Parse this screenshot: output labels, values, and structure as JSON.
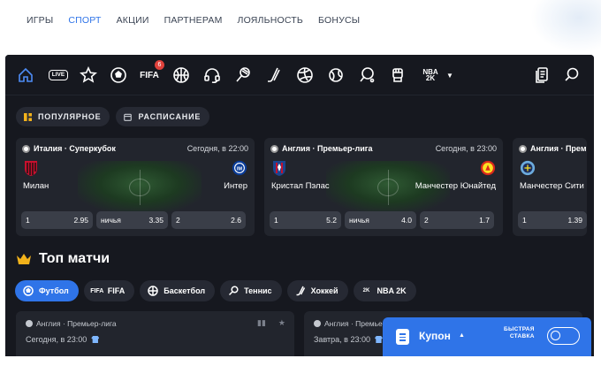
{
  "topnav": {
    "items": [
      {
        "label": "ИГРЫ",
        "active": false
      },
      {
        "label": "СПОРТ",
        "active": true
      },
      {
        "label": "АКЦИИ",
        "active": false
      },
      {
        "label": "ПАРТНЕРАМ",
        "active": false
      },
      {
        "label": "ЛОЯЛЬНОСТЬ",
        "active": false
      },
      {
        "label": "БОНУСЫ",
        "active": false
      }
    ]
  },
  "iconbar": {
    "live_label": "LIVE",
    "fifa_label": "FIFA",
    "fifa_badge": "6",
    "nba_label": "NBA 2K",
    "icons": [
      "home-icon",
      "live-icon",
      "star-icon",
      "football-icon",
      "fifa-icon",
      "basketball-icon",
      "esports-headset-icon",
      "tennis-icon",
      "hockey-icon",
      "volleyball-icon",
      "handball-icon",
      "table-tennis-icon",
      "mma-icon",
      "nba2k-icon",
      "chevron-down-icon",
      "betslip-icon",
      "search-icon"
    ]
  },
  "chips": {
    "popular": "ПОПУЛЯРНОЕ",
    "schedule": "РАСПИСАНИЕ"
  },
  "featured": [
    {
      "league": "Италия · Суперкубок",
      "time": "Сегодня, в 22:00",
      "home": "Милан",
      "away": "Интер",
      "odds": [
        {
          "label": "1",
          "value": "2.95"
        },
        {
          "label": "ничья",
          "value": "3.35"
        },
        {
          "label": "2",
          "value": "2.6"
        }
      ]
    },
    {
      "league": "Англия · Премьер-лига",
      "time": "Сегодня, в 23:00",
      "home": "Кристал Пэлас",
      "away": "Манчестер Юнайтед",
      "odds": [
        {
          "label": "1",
          "value": "5.2"
        },
        {
          "label": "ничья",
          "value": "4.0"
        },
        {
          "label": "2",
          "value": "1.7"
        }
      ]
    },
    {
      "league": "Англия · Премь",
      "time": "",
      "home": "Манчестер Сити",
      "away": "",
      "odds": [
        {
          "label": "1",
          "value": "1.39"
        }
      ]
    }
  ],
  "top_matches": {
    "title": "Топ матчи",
    "sports": [
      {
        "label": "Футбол",
        "active": true
      },
      {
        "label": "FIFA",
        "active": false
      },
      {
        "label": "Баскетбол",
        "active": false
      },
      {
        "label": "Теннис",
        "active": false
      },
      {
        "label": "Хоккей",
        "active": false
      },
      {
        "label": "NBA 2K",
        "active": false
      }
    ],
    "cards": [
      {
        "league": "Англия · Премьер-лига",
        "time": "Сегодня, в 23:00"
      },
      {
        "league": "Англия · Премьер-лига",
        "time": "Завтра, в 23:00"
      }
    ]
  },
  "coupon": {
    "label": "Купон",
    "quick_bet_line1": "БЫСТРАЯ",
    "quick_bet_line2": "СТАВКА",
    "quick_bet_enabled": false
  },
  "colors": {
    "accent": "#2f74e8",
    "app_bg": "#16181f",
    "card_bg": "#22252d",
    "badge": "#e0413b"
  }
}
